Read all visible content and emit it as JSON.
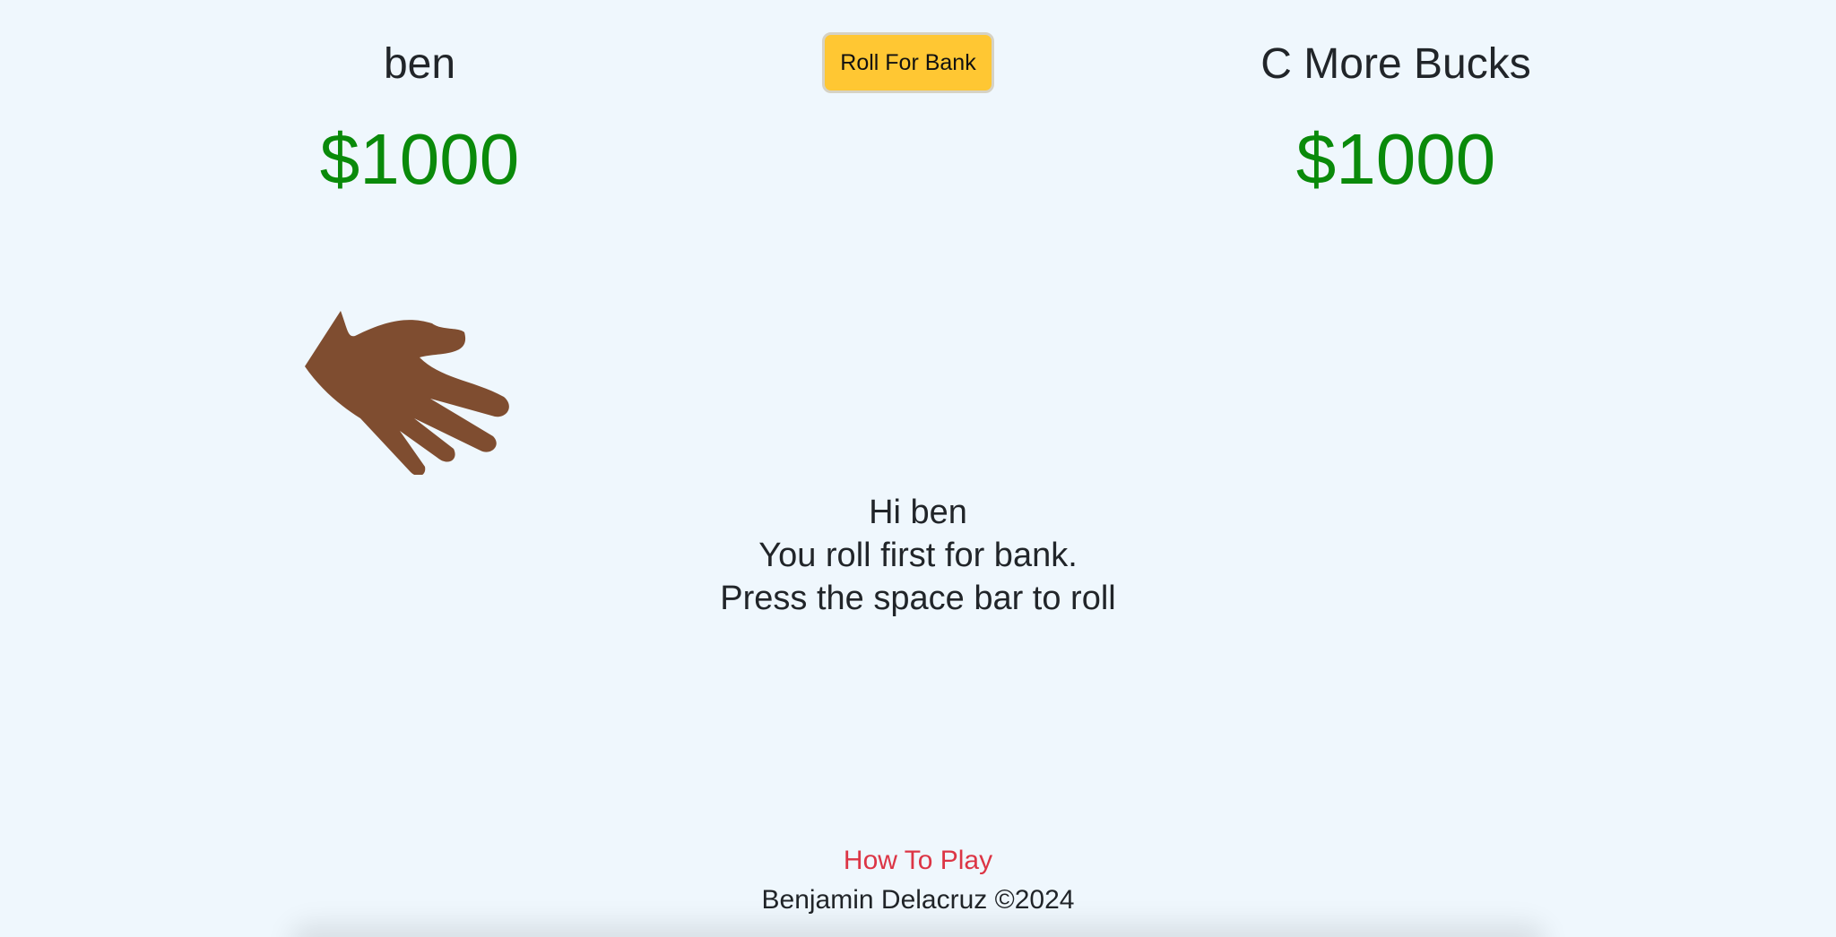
{
  "players": {
    "left": {
      "name": "ben",
      "money": "$1000"
    },
    "right": {
      "name": "C More Bucks",
      "money": "$1000"
    }
  },
  "controls": {
    "roll_button_label": "Roll For Bank"
  },
  "message": {
    "line1": "Hi ben",
    "line2": "You roll first for bank.",
    "line3": "Press the space bar to roll"
  },
  "footer": {
    "how_to_play": "How To Play",
    "credit": "Benjamin Delacruz ©2024"
  },
  "colors": {
    "background": "#eff7fd",
    "money": "#0a8a0a",
    "button": "#ffc733",
    "link": "#dc3545",
    "hand": "#7f4d30"
  },
  "icons": {
    "hand": "open-hand-icon"
  }
}
